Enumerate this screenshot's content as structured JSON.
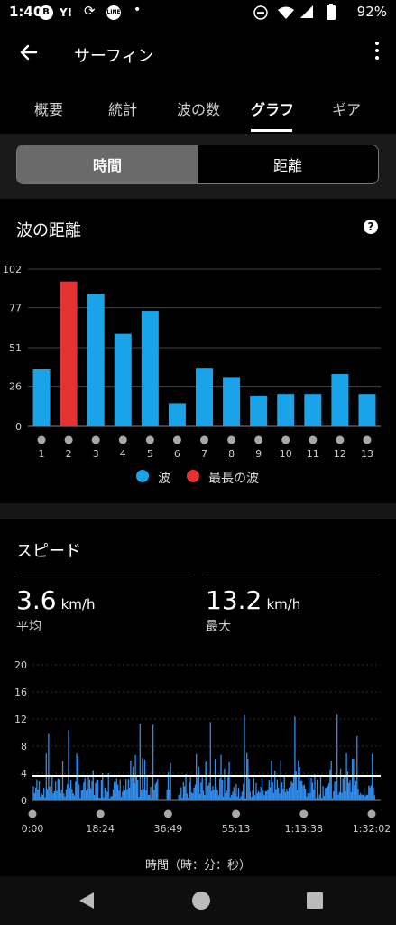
{
  "status_bar": {
    "time": "1:40",
    "icons": [
      "b-badge-icon",
      "yahoo-icon",
      "sync-icon",
      "line-icon",
      "dot-icon",
      "dnd-icon",
      "wifi-icon",
      "signal-icon",
      "battery-icon"
    ],
    "yahoo_text": "Y!",
    "line_text": "LINE",
    "battery": "92%"
  },
  "app_bar": {
    "title": "サーフィン"
  },
  "tabs": [
    {
      "label": "概要"
    },
    {
      "label": "統計"
    },
    {
      "label": "波の数"
    },
    {
      "label": "グラフ",
      "active": true
    },
    {
      "label": "ギア"
    }
  ],
  "segment": {
    "time_label": "時間",
    "distance_label": "距離",
    "selected": "時間"
  },
  "wave_card": {
    "title": "波の距離",
    "legend": [
      {
        "label": "波",
        "color": "#1aa3e8"
      },
      {
        "label": "最長の波",
        "color": "#e53333"
      }
    ]
  },
  "speed_card": {
    "title": "スピード",
    "avg_value": "3.6",
    "avg_unit": "km/h",
    "avg_label": "平均",
    "max_value": "13.2",
    "max_unit": "km/h",
    "max_label": "最大",
    "x_axis_title": "時間（時：分：秒）"
  },
  "chart_data": [
    {
      "type": "bar",
      "title": "波の距離",
      "categories": [
        "1",
        "2",
        "3",
        "4",
        "5",
        "6",
        "7",
        "8",
        "9",
        "10",
        "11",
        "12",
        "13"
      ],
      "values": [
        37,
        94,
        86,
        60,
        75,
        15,
        38,
        32,
        20,
        21,
        21,
        34,
        21
      ],
      "highlight_index": 1,
      "series": [
        {
          "name": "波",
          "color": "#1aa3e8"
        },
        {
          "name": "最長の波",
          "color": "#e53333"
        }
      ],
      "yticks": [
        0,
        26,
        51,
        77,
        102
      ],
      "ylim": [
        0,
        102
      ],
      "grid": true,
      "legend": "bottom"
    },
    {
      "type": "area",
      "title": "スピード",
      "xlabel": "時間（時：分：秒）",
      "xticks": [
        "0:00",
        "18:24",
        "36:49",
        "55:13",
        "1:13:38",
        "1:32:02"
      ],
      "yticks": [
        0,
        4,
        8,
        12,
        16,
        20
      ],
      "ylim": [
        0,
        20
      ],
      "average_line": 3.6,
      "max": 13.2,
      "series_color": "#2f8ef0"
    }
  ],
  "nav_bar": {
    "icons": [
      "back-triangle-icon",
      "home-circle-icon",
      "recents-square-icon"
    ]
  }
}
